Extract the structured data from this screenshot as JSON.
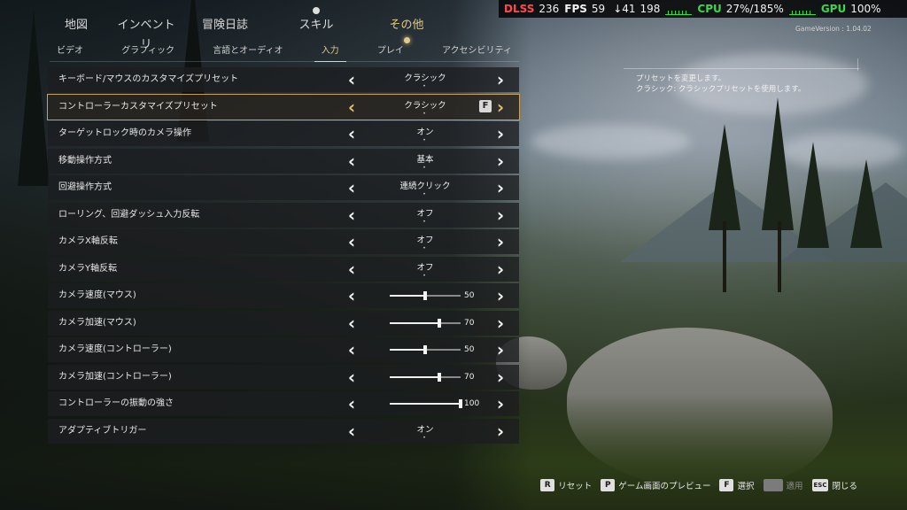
{
  "perf": {
    "dlss_label": "DLSS",
    "dlss_value": "236",
    "fps_label": "FPS",
    "fps_value": "59",
    "low_value": "↓41",
    "frame_value": "198",
    "cpu_label": "CPU",
    "cpu_value": "27%/185%",
    "gpu_label": "GPU",
    "gpu_value": "100%"
  },
  "top_tabs": [
    "地図",
    "インベントリ",
    "冒険日誌",
    "スキル",
    "その他"
  ],
  "active_top_tab": "その他",
  "sub_tabs": [
    "ビデオ",
    "グラフィック",
    "言語とオーディオ",
    "入力",
    "プレイ",
    "アクセシビリティ"
  ],
  "active_sub_tab": "入力",
  "game_version": "GameVersion : 1.04.02",
  "settings": [
    {
      "label": "キーボード/マウスのカスタマイズプリセット",
      "value": "クラシック"
    },
    {
      "label": "コントローラーカスタマイズプリセット",
      "value": "クラシック",
      "selected": true,
      "hint_key": "F"
    },
    {
      "label": "ターゲットロック時のカメラ操作",
      "value": "オン"
    },
    {
      "label": "移動操作方式",
      "value": "基本"
    },
    {
      "label": "回避操作方式",
      "value": "連続クリック"
    },
    {
      "label": "ローリング、回避ダッシュ入力反転",
      "value": "オフ"
    },
    {
      "label": "カメラX軸反転",
      "value": "オフ"
    },
    {
      "label": "カメラY軸反転",
      "value": "オフ"
    },
    {
      "label": "カメラ速度(マウス)",
      "slider": 50
    },
    {
      "label": "カメラ加速(マウス)",
      "slider": 70
    },
    {
      "label": "カメラ速度(コントローラー)",
      "slider": 50
    },
    {
      "label": "カメラ加速(コントローラー)",
      "slider": 70
    },
    {
      "label": "コントローラーの振動の強さ",
      "slider": 100
    },
    {
      "label": "アダプティブトリガー",
      "value": "オン"
    }
  ],
  "description": {
    "line1": "プリセットを変更します。",
    "line2": "クラシック: クラシックプリセットを使用します。"
  },
  "footer": {
    "reset_key": "R",
    "reset_label": "リセット",
    "preview_key": "P",
    "preview_label": "ゲーム画面のプレビュー",
    "select_key": "F",
    "select_label": "選択",
    "apply_label": "適用",
    "close_key": "ESC",
    "close_label": "閉じる"
  },
  "colors": {
    "accent": "#e2c98a",
    "selected_border": "#c8a15c",
    "perf_red": "#ff4b4b",
    "perf_green": "#39d84a"
  }
}
